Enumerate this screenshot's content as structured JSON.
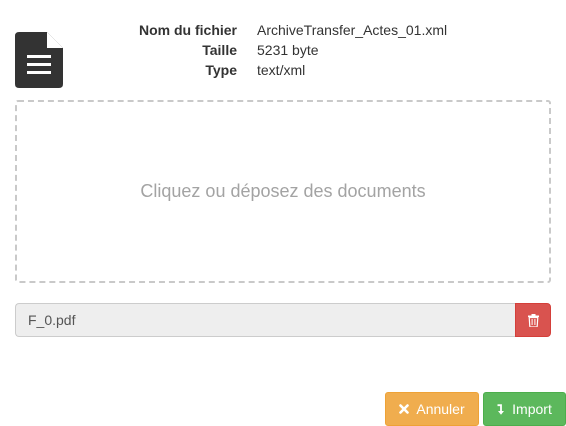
{
  "file_details": {
    "name_label": "Nom du fichier",
    "name_value": "ArchiveTransfer_Actes_01.xml",
    "size_label": "Taille",
    "size_value": "5231 byte",
    "type_label": "Type",
    "type_value": "text/xml"
  },
  "icons": {
    "file": "file-text-icon",
    "delete": "trash-icon",
    "cancel": "times-icon",
    "import": "level-down-icon"
  },
  "dropzone": {
    "text": "Cliquez ou déposez des documents"
  },
  "attached_file": {
    "name": "F_0.pdf"
  },
  "actions": {
    "cancel_label": "Annuler",
    "import_label": "Import"
  },
  "colors": {
    "cancel": "#f0ad4e",
    "import": "#5cb85c",
    "delete": "#d9534f",
    "icon": "#333333"
  }
}
